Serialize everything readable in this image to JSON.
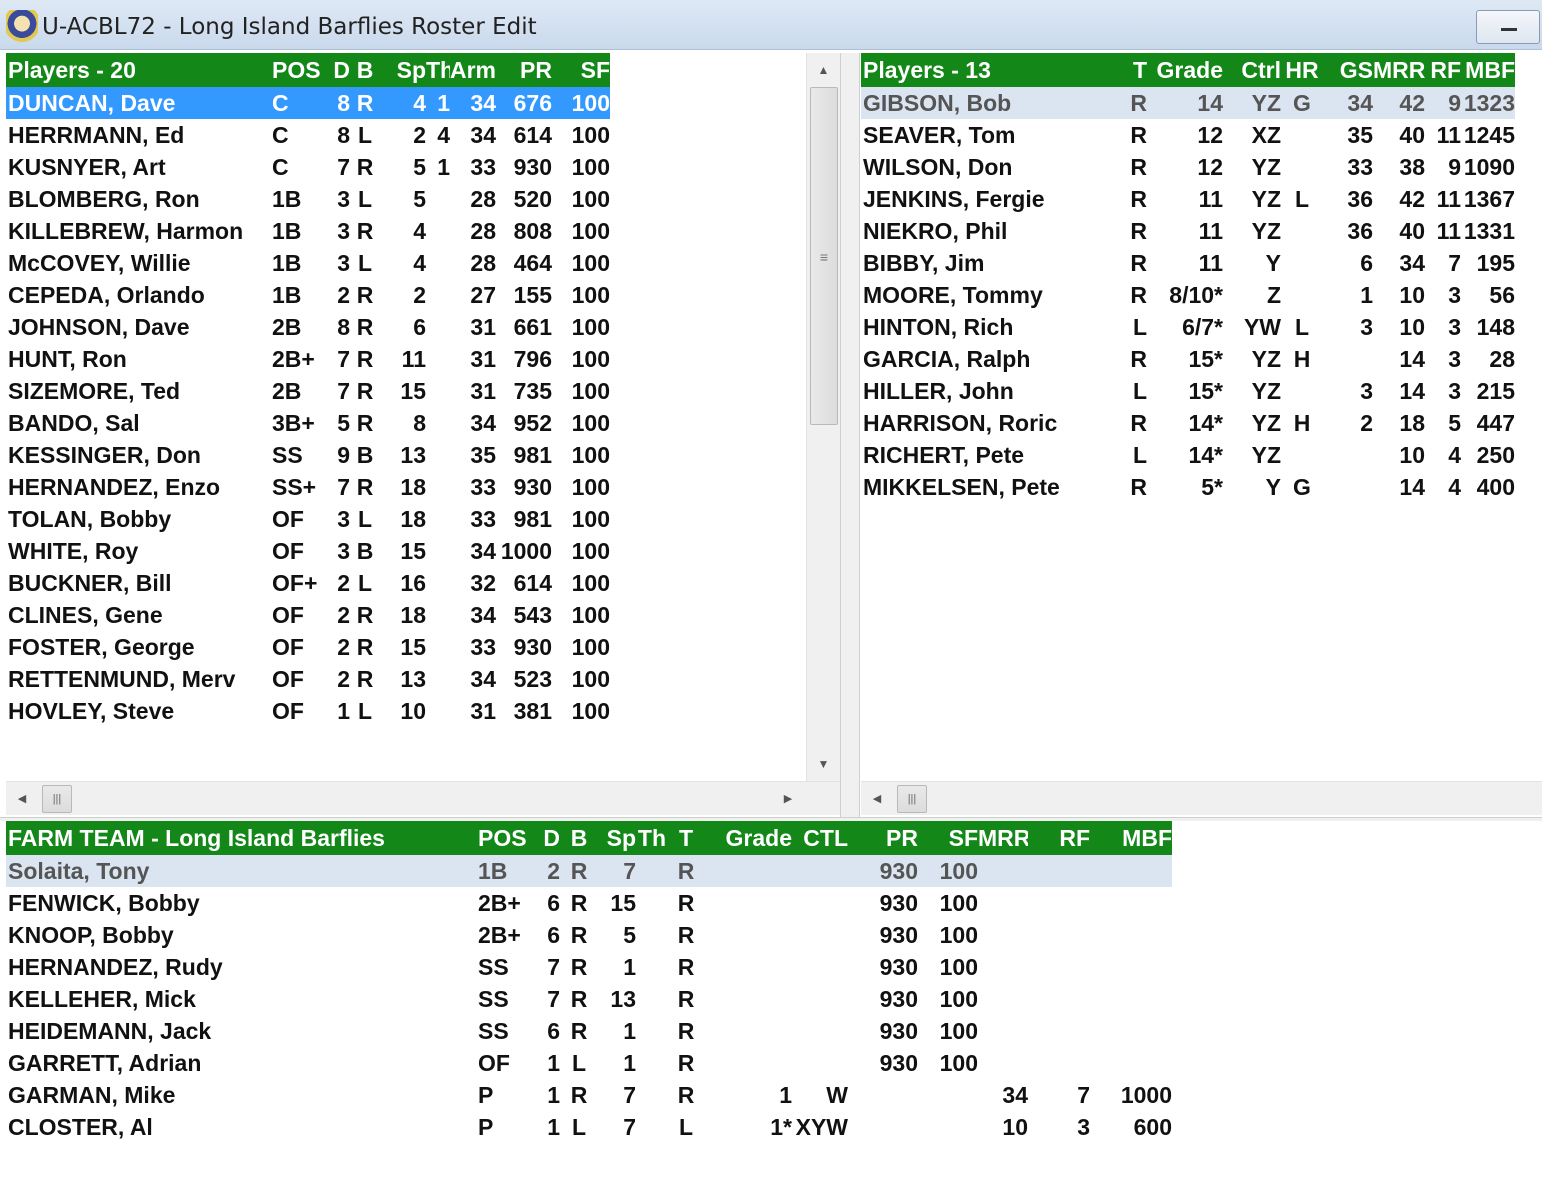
{
  "window": {
    "title": "U-ACBL72 - Long Island Barflies Roster Edit",
    "minimize_glyph": "—"
  },
  "hitters": {
    "headers": [
      "Players - 20",
      "POS",
      "D",
      "B",
      "Sp",
      "Th",
      "Arm",
      "PR",
      "SF"
    ],
    "rows": [
      [
        "DUNCAN, Dave",
        "C",
        "8",
        "R",
        "4",
        "1",
        "34",
        "676",
        "100"
      ],
      [
        "HERRMANN, Ed",
        "C",
        "8",
        "L",
        "2",
        "4",
        "34",
        "614",
        "100"
      ],
      [
        "KUSNYER, Art",
        "C",
        "7",
        "R",
        "5",
        "1",
        "33",
        "930",
        "100"
      ],
      [
        "BLOMBERG, Ron",
        "1B",
        "3",
        "L",
        "5",
        "",
        "28",
        "520",
        "100"
      ],
      [
        "KILLEBREW, Harmon",
        "1B",
        "3",
        "R",
        "4",
        "",
        "28",
        "808",
        "100"
      ],
      [
        "McCOVEY, Willie",
        "1B",
        "3",
        "L",
        "4",
        "",
        "28",
        "464",
        "100"
      ],
      [
        "CEPEDA, Orlando",
        "1B",
        "2",
        "R",
        "2",
        "",
        "27",
        "155",
        "100"
      ],
      [
        "JOHNSON, Dave",
        "2B",
        "8",
        "R",
        "6",
        "",
        "31",
        "661",
        "100"
      ],
      [
        "HUNT, Ron",
        "2B+",
        "7",
        "R",
        "11",
        "",
        "31",
        "796",
        "100"
      ],
      [
        "SIZEMORE, Ted",
        "2B",
        "7",
        "R",
        "15",
        "",
        "31",
        "735",
        "100"
      ],
      [
        "BANDO, Sal",
        "3B+",
        "5",
        "R",
        "8",
        "",
        "34",
        "952",
        "100"
      ],
      [
        "KESSINGER, Don",
        "SS",
        "9",
        "B",
        "13",
        "",
        "35",
        "981",
        "100"
      ],
      [
        "HERNANDEZ, Enzo",
        "SS+",
        "7",
        "R",
        "18",
        "",
        "33",
        "930",
        "100"
      ],
      [
        "TOLAN, Bobby",
        "OF",
        "3",
        "L",
        "18",
        "",
        "33",
        "981",
        "100"
      ],
      [
        "WHITE, Roy",
        "OF",
        "3",
        "B",
        "15",
        "",
        "34",
        "1000",
        "100"
      ],
      [
        "BUCKNER, Bill",
        "OF+",
        "2",
        "L",
        "16",
        "",
        "32",
        "614",
        "100"
      ],
      [
        "CLINES, Gene",
        "OF",
        "2",
        "R",
        "18",
        "",
        "34",
        "543",
        "100"
      ],
      [
        "FOSTER, George",
        "OF",
        "2",
        "R",
        "15",
        "",
        "33",
        "930",
        "100"
      ],
      [
        "RETTENMUND, Merv",
        "OF",
        "2",
        "R",
        "13",
        "",
        "34",
        "523",
        "100"
      ],
      [
        "HOVLEY, Steve",
        "OF",
        "1",
        "L",
        "10",
        "",
        "31",
        "381",
        "100"
      ]
    ]
  },
  "pitchers": {
    "headers": [
      "Players - 13",
      "T",
      "Grade",
      "Ctrl",
      "HR",
      "GS",
      "MRR",
      "RF",
      "MBF"
    ],
    "rows": [
      [
        "GIBSON, Bob",
        "R",
        "14",
        "YZ",
        "G",
        "34",
        "42",
        "9",
        "1323"
      ],
      [
        "SEAVER, Tom",
        "R",
        "12",
        "XZ",
        "",
        "35",
        "40",
        "11",
        "1245"
      ],
      [
        "WILSON, Don",
        "R",
        "12",
        "YZ",
        "",
        "33",
        "38",
        "9",
        "1090"
      ],
      [
        "JENKINS, Fergie",
        "R",
        "11",
        "YZ",
        "L",
        "36",
        "42",
        "11",
        "1367"
      ],
      [
        "NIEKRO, Phil",
        "R",
        "11",
        "YZ",
        "",
        "36",
        "40",
        "11",
        "1331"
      ],
      [
        "BIBBY, Jim",
        "R",
        "11",
        "Y",
        "",
        "6",
        "34",
        "7",
        "195"
      ],
      [
        "MOORE, Tommy",
        "R",
        "8/10*",
        "Z",
        "",
        "1",
        "10",
        "3",
        "56"
      ],
      [
        "HINTON, Rich",
        "L",
        "6/7*",
        "YW",
        "L",
        "3",
        "10",
        "3",
        "148"
      ],
      [
        "GARCIA, Ralph",
        "R",
        "15*",
        "YZ",
        "H",
        "",
        "14",
        "3",
        "28"
      ],
      [
        "HILLER, John",
        "L",
        "15*",
        "YZ",
        "",
        "3",
        "14",
        "3",
        "215"
      ],
      [
        "HARRISON, Roric",
        "R",
        "14*",
        "YZ",
        "H",
        "2",
        "18",
        "5",
        "447"
      ],
      [
        "RICHERT, Pete",
        "L",
        "14*",
        "YZ",
        "",
        "",
        "10",
        "4",
        "250"
      ],
      [
        "MIKKELSEN, Pete",
        "R",
        "5*",
        "Y",
        "G",
        "",
        "14",
        "4",
        "400"
      ]
    ]
  },
  "farm": {
    "headers": [
      "FARM TEAM - Long Island Barflies",
      "POS",
      "D",
      "B",
      "Sp",
      "Th",
      "T",
      "Grade",
      "CTL",
      "PR",
      "SF",
      "MRR",
      "RF",
      "MBF"
    ],
    "rows": [
      [
        "Solaita, Tony",
        "1B",
        "2",
        "R",
        "7",
        "",
        "R",
        "",
        "",
        "930",
        "100",
        "",
        "",
        ""
      ],
      [
        "FENWICK, Bobby",
        "2B+",
        "6",
        "R",
        "15",
        "",
        "R",
        "",
        "",
        "930",
        "100",
        "",
        "",
        ""
      ],
      [
        "KNOOP, Bobby",
        "2B+",
        "6",
        "R",
        "5",
        "",
        "R",
        "",
        "",
        "930",
        "100",
        "",
        "",
        ""
      ],
      [
        "HERNANDEZ, Rudy",
        "SS",
        "7",
        "R",
        "1",
        "",
        "R",
        "",
        "",
        "930",
        "100",
        "",
        "",
        ""
      ],
      [
        "KELLEHER, Mick",
        "SS",
        "7",
        "R",
        "13",
        "",
        "R",
        "",
        "",
        "930",
        "100",
        "",
        "",
        ""
      ],
      [
        "HEIDEMANN, Jack",
        "SS",
        "6",
        "R",
        "1",
        "",
        "R",
        "",
        "",
        "930",
        "100",
        "",
        "",
        ""
      ],
      [
        "GARRETT, Adrian",
        "OF",
        "1",
        "L",
        "1",
        "",
        "R",
        "",
        "",
        "930",
        "100",
        "",
        "",
        ""
      ],
      [
        "GARMAN, Mike",
        "P",
        "1",
        "R",
        "7",
        "",
        "R",
        "1",
        "W",
        "",
        "",
        "34",
        "7",
        "1000"
      ],
      [
        "CLOSTER, Al",
        "P",
        "1",
        "L",
        "7",
        "",
        "L",
        "1*",
        "XYW",
        "",
        "",
        "10",
        "3",
        "600"
      ]
    ]
  },
  "scroll": {
    "up_glyph": "▲",
    "down_glyph": "▼",
    "left_glyph": "◀",
    "right_glyph": "▶",
    "grip_glyph": "|||",
    "vgrip_glyph": "≡"
  },
  "colors": {
    "header_green": "#138818",
    "selected_blue": "#3399ff",
    "focus_row": "#dbe5f1"
  },
  "icons": {
    "app": "team-logo-icon"
  }
}
